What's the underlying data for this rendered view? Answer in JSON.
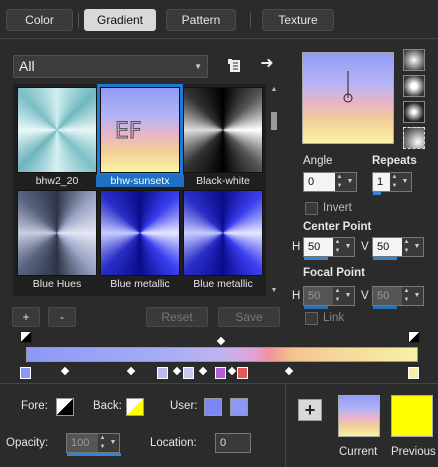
{
  "tabs": [
    "Color",
    "Gradient",
    "Pattern",
    "Texture"
  ],
  "active_tab": "Gradient",
  "category": {
    "selected": "All"
  },
  "gradients": [
    {
      "name": "bhw2_20"
    },
    {
      "name": "bhw-sunsetx",
      "selected": true
    },
    {
      "name": "Black-white"
    },
    {
      "name": "Blue Hues"
    },
    {
      "name": "Blue metallic"
    },
    {
      "name": "Blue metallic"
    }
  ],
  "buttons": {
    "add": "+",
    "remove": "-",
    "reset": "Reset",
    "save": "Save",
    "add_color": "+"
  },
  "angle": {
    "label": "Angle",
    "value": "0"
  },
  "repeats": {
    "label": "Repeats",
    "value": "1"
  },
  "invert": {
    "label": "Invert"
  },
  "center_point": {
    "label": "Center Point",
    "h_label": "H",
    "h_value": "50",
    "v_label": "V",
    "v_value": "50"
  },
  "focal_point": {
    "label": "Focal Point",
    "h_label": "H",
    "h_value": "50",
    "v_label": "V",
    "v_value": "50"
  },
  "link": {
    "label": "Link"
  },
  "fore": {
    "label": "Fore:"
  },
  "back": {
    "label": "Back:"
  },
  "user": {
    "label": "User:"
  },
  "opacity": {
    "label": "Opacity:",
    "value": "100"
  },
  "location": {
    "label": "Location:",
    "value": "0"
  },
  "current": {
    "label": "Current"
  },
  "previous": {
    "label": "Previous"
  },
  "colors": {
    "accent": "#1f7ad6",
    "user_color_1": "#7c86f5",
    "user_color_2": "#8e97f6",
    "previous": "#ffff00"
  }
}
